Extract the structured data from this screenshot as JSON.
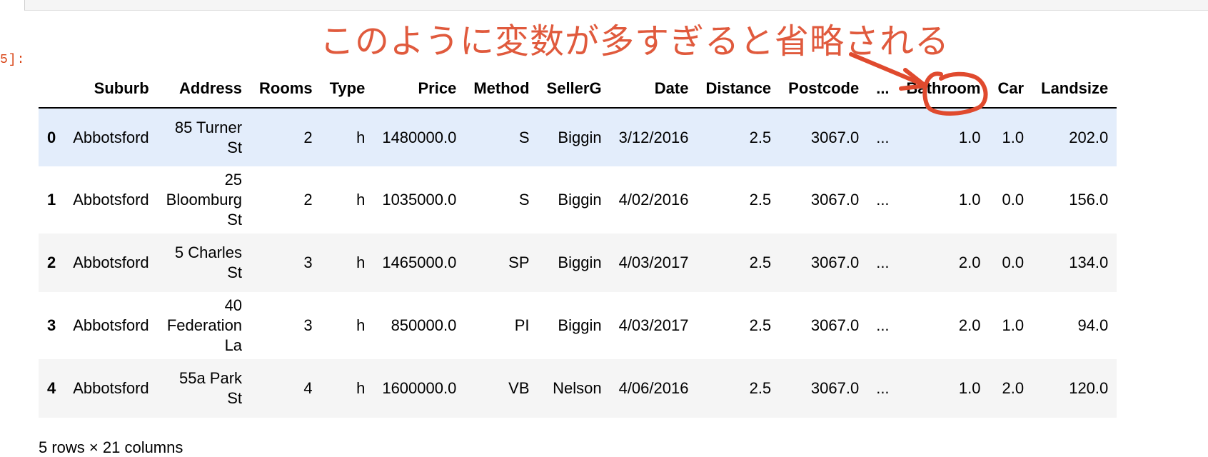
{
  "prompt_label": "5]:",
  "annotation": {
    "text": "このように変数が多すぎると省略される",
    "color": "#e05a3d"
  },
  "columns": [
    "",
    "Suburb",
    "Address",
    "Rooms",
    "Type",
    "Price",
    "Method",
    "SellerG",
    "Date",
    "Distance",
    "Postcode",
    "...",
    "Bathroom",
    "Car",
    "Landsize"
  ],
  "rows": [
    [
      "0",
      "Abbotsford",
      "85 Turner St",
      "2",
      "h",
      "1480000.0",
      "S",
      "Biggin",
      "3/12/2016",
      "2.5",
      "3067.0",
      "...",
      "1.0",
      "1.0",
      "202.0"
    ],
    [
      "1",
      "Abbotsford",
      "25 Bloomburg St",
      "2",
      "h",
      "1035000.0",
      "S",
      "Biggin",
      "4/02/2016",
      "2.5",
      "3067.0",
      "...",
      "1.0",
      "0.0",
      "156.0"
    ],
    [
      "2",
      "Abbotsford",
      "5 Charles St",
      "3",
      "h",
      "1465000.0",
      "SP",
      "Biggin",
      "4/03/2017",
      "2.5",
      "3067.0",
      "...",
      "2.0",
      "0.0",
      "134.0"
    ],
    [
      "3",
      "Abbotsford",
      "40 Federation La",
      "3",
      "h",
      "850000.0",
      "PI",
      "Biggin",
      "4/03/2017",
      "2.5",
      "3067.0",
      "...",
      "2.0",
      "1.0",
      "94.0"
    ],
    [
      "4",
      "Abbotsford",
      "55a Park St",
      "4",
      "h",
      "1600000.0",
      "VB",
      "Nelson",
      "4/06/2016",
      "2.5",
      "3067.0",
      "...",
      "1.0",
      "2.0",
      "120.0"
    ]
  ],
  "footer": "5 rows × 21 columns"
}
